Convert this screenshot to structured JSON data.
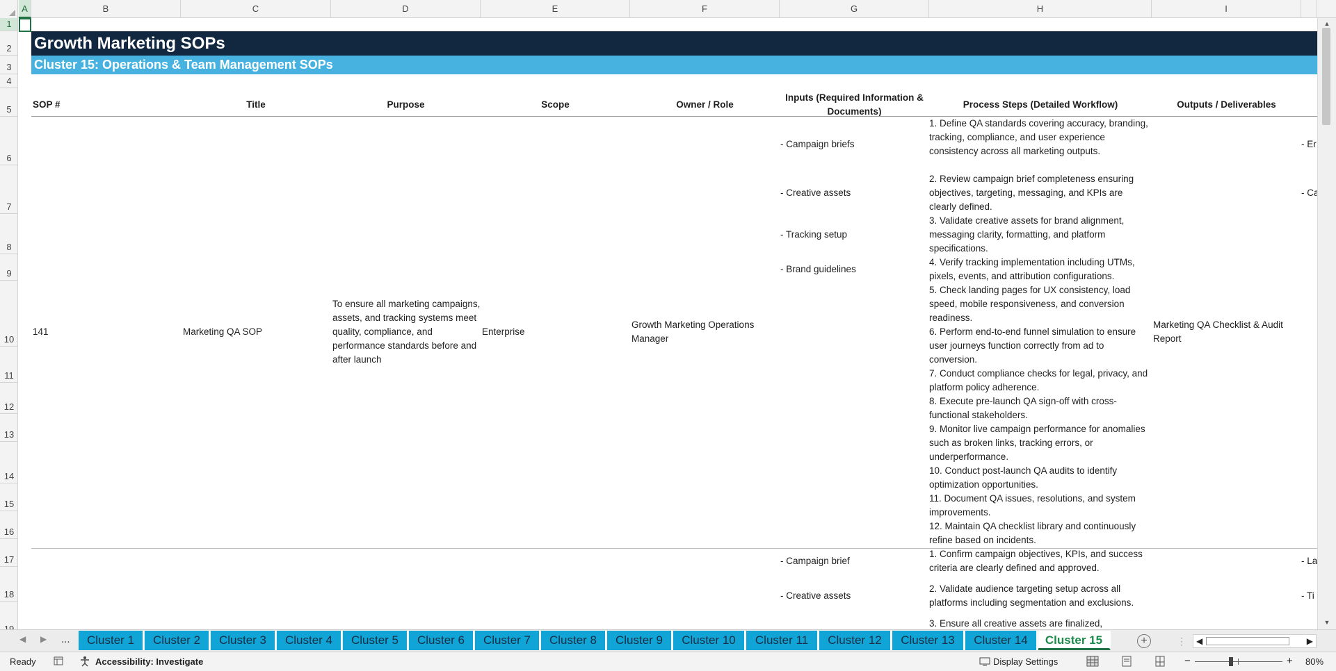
{
  "columns": [
    "A",
    "B",
    "C",
    "D",
    "E",
    "F",
    "G",
    "H",
    "I"
  ],
  "rows": [
    "1",
    "2",
    "3",
    "4",
    "5",
    "6",
    "7",
    "8",
    "9",
    "10",
    "11",
    "12",
    "13",
    "14",
    "15",
    "16",
    "17",
    "18",
    "19"
  ],
  "banner": {
    "title": "Growth Marketing SOPs",
    "subtitle": "Cluster 15: Operations & Team Management SOPs"
  },
  "headers": {
    "sop": "SOP #",
    "title": "Title",
    "purpose": "Purpose",
    "scope": "Scope",
    "owner": "Owner / Role",
    "inputs": "Inputs (Required Information & Documents)",
    "steps": "Process Steps (Detailed Workflow)",
    "outputs": "Outputs / Deliverables"
  },
  "sop141": {
    "number": "141",
    "title": "Marketing QA SOP",
    "purpose": "To ensure all marketing campaigns, assets, and tracking systems meet quality, compliance, and performance standards before and after launch",
    "scope": "Enterprise",
    "owner": "Growth Marketing Operations Manager",
    "inputs": [
      "- Campaign briefs",
      "- Creative assets",
      "- Tracking setup",
      "- Brand guidelines"
    ],
    "steps": [
      "1. Define QA standards covering accuracy, branding, tracking, compliance, and user experience consistency across all marketing outputs.",
      "2. Review campaign brief completeness ensuring objectives, targeting, messaging, and KPIs are clearly defined.",
      "3. Validate creative assets for brand alignment, messaging clarity, formatting, and platform specifications.",
      "4. Verify tracking implementation including UTMs, pixels, events, and attribution configurations.",
      "5. Check landing pages for UX consistency, load speed, mobile responsiveness, and conversion readiness.",
      "6. Perform end-to-end funnel simulation to ensure user journeys function correctly from ad to conversion.",
      "7. Conduct compliance checks for legal, privacy, and platform policy adherence.",
      "8. Execute pre-launch QA sign-off with cross-functional stakeholders.",
      "9. Monitor live campaign performance for anomalies such as broken links, tracking errors, or underperformance.",
      "10. Conduct post-launch QA audits to identify optimization opportunities.",
      "11. Document QA issues, resolutions, and system improvements.",
      "12. Maintain QA checklist library and continuously refine based on incidents."
    ],
    "outputs": "Marketing QA Checklist & Audit Report",
    "outputs_cut": [
      "- Er",
      "- Ca"
    ]
  },
  "sop_next": {
    "inputs": [
      "- Campaign brief",
      "- Creative assets"
    ],
    "steps": [
      "1. Confirm campaign objectives, KPIs, and success criteria are clearly defined and approved.",
      "2. Validate audience targeting setup across all platforms including segmentation and exclusions.",
      "3. Ensure all creative assets are finalized,"
    ],
    "outputs_cut": [
      "- La",
      "- Ti"
    ]
  },
  "tabs": {
    "ellipsis": "...",
    "items": [
      "Cluster 1",
      "Cluster 2",
      "Cluster 3",
      "Cluster 4",
      "Cluster 5",
      "Cluster 6",
      "Cluster 7",
      "Cluster 8",
      "Cluster 9",
      "Cluster 10",
      "Cluster 11",
      "Cluster 12",
      "Cluster 13",
      "Cluster 14",
      "Cluster 15"
    ],
    "active": "Cluster 15"
  },
  "status": {
    "ready": "Ready",
    "accessibility": "Accessibility: Investigate",
    "display_settings": "Display Settings",
    "zoom": "80%"
  },
  "colors": {
    "banner_dark": "#112840",
    "banner_light": "#47b2e0",
    "tab": "#10a5d6",
    "excel_green": "#217346"
  }
}
